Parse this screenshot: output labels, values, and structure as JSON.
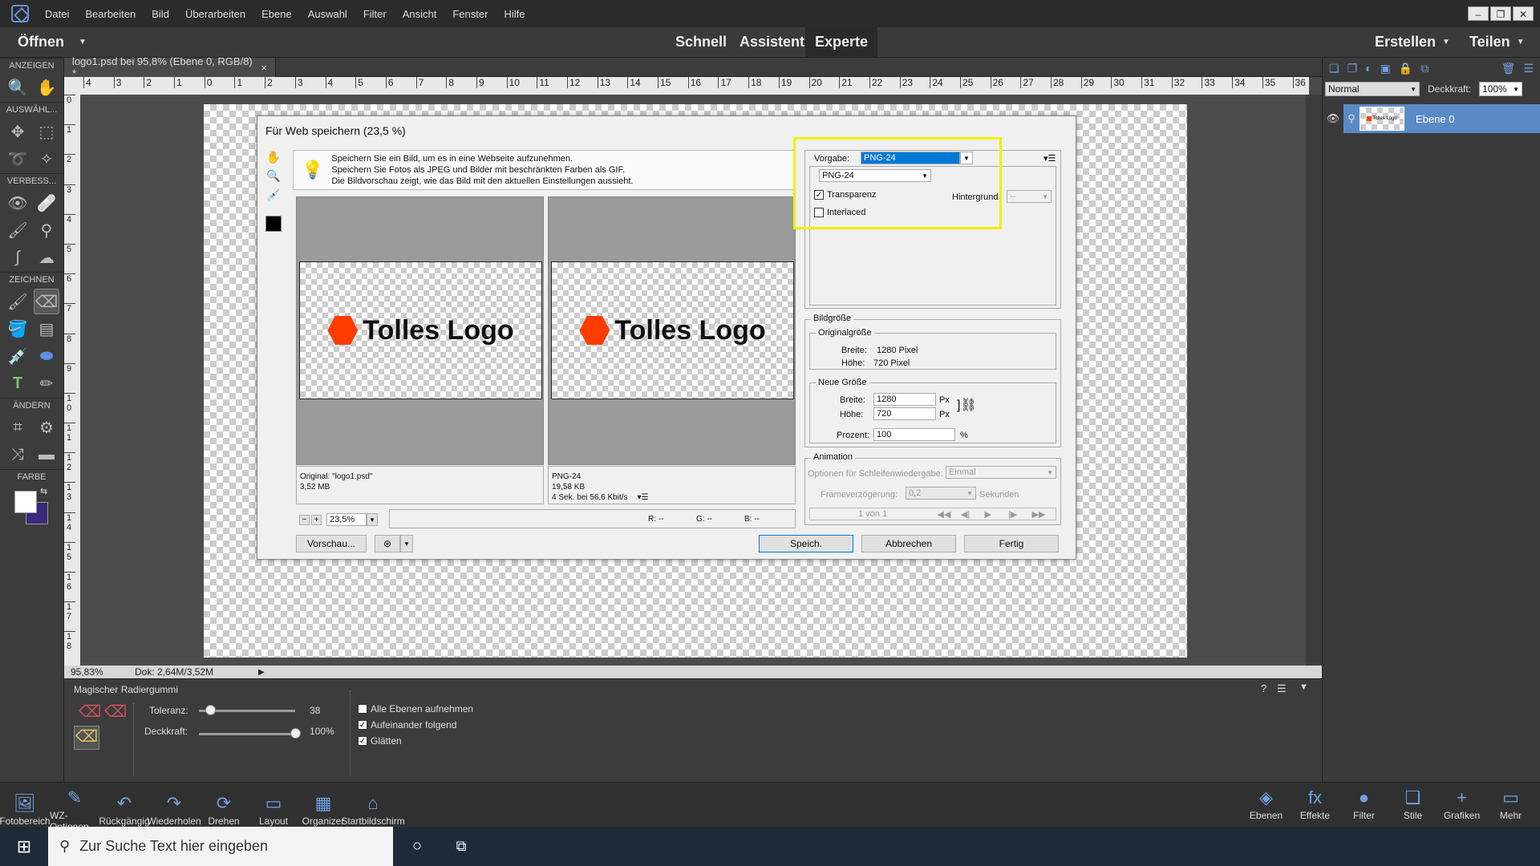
{
  "menubar": {
    "items": [
      "Datei",
      "Bearbeiten",
      "Bild",
      "Überarbeiten",
      "Ebene",
      "Auswahl",
      "Filter",
      "Ansicht",
      "Fenster",
      "Hilfe"
    ],
    "win_min": "–",
    "win_max": "❐",
    "win_close": "✕"
  },
  "modebar": {
    "open": "Öffnen",
    "modes": [
      "Schnell",
      "Assistent",
      "Experte"
    ],
    "create": "Erstellen",
    "share": "Teilen"
  },
  "tools": {
    "sections": [
      "ANZEIGEN",
      "AUSWÄHL...",
      "VERBESS...",
      "ZEICHNEN",
      "ÄNDERN",
      "FARBE"
    ]
  },
  "doc": {
    "tab": "logo1.psd bei 95,8% (Ebene 0, RGB/8) *",
    "close": "×",
    "zoom": "95,83%",
    "docinfo": "Dok: 2,64M/3,52M"
  },
  "ruler": {
    "h": [
      "4",
      "3",
      "2",
      "1",
      "0",
      "1",
      "2",
      "3",
      "4",
      "5",
      "6",
      "7",
      "8",
      "9",
      "10",
      "11",
      "12",
      "13",
      "14",
      "15",
      "16",
      "17",
      "18",
      "19",
      "20",
      "21",
      "22",
      "23",
      "24",
      "25",
      "26",
      "27",
      "28",
      "29",
      "30",
      "31",
      "32",
      "33",
      "34",
      "35",
      "36"
    ],
    "v": [
      "0",
      "1",
      "2",
      "3",
      "4",
      "5",
      "6",
      "7",
      "8",
      "9",
      "1 0",
      "1 1",
      "1 2",
      "1 3",
      "1 4",
      "1 5",
      "1 6",
      "1 7",
      "1 8"
    ]
  },
  "dialog": {
    "title": "Für Web speichern (23,5 %)",
    "info": [
      "Speichern Sie ein Bild, um es in eine Webseite aufzunehmen.",
      "Speichern Sie Fotos als JPEG und Bilder mit beschränkten Farben als GIF.",
      "Die Bildvorschau zeigt, wie das Bild mit den aktuellen Einstellungen aussieht."
    ],
    "logo_text": "Tolles Logo",
    "orig_info": [
      "Original: \"logo1.psd\"",
      "3,52 MB"
    ],
    "opt_info": [
      "PNG-24",
      "19,58 KB",
      "4 Sek. bei 56,6 Kbit/s"
    ],
    "zoom": "23,5%",
    "rgb": [
      "R: --",
      "G: --",
      "B: --"
    ],
    "preset_label": "Vorgabe:",
    "preset_value": "PNG-24",
    "format_value": "PNG-24",
    "transparency": "Transparenz",
    "interlaced": "Interlaced",
    "background_label": "Hintergrund",
    "background_value": "--",
    "imgsize_title": "Bildgröße",
    "origsize_title": "Originalgröße",
    "orig_width_label": "Breite:",
    "orig_width": "1280 Pixel",
    "orig_height_label": "Höhe:",
    "orig_height": "720 Pixel",
    "newsize_title": "Neue Größe",
    "new_width_label": "Breite:",
    "new_width": "1280",
    "new_height_label": "Höhe:",
    "new_height": "720",
    "unit": "Px",
    "percent_label": "Prozent:",
    "percent": "100",
    "percent_unit": "%",
    "anim_title": "Animation",
    "loop_label": "Optionen für Schleifenwiedergabe:",
    "loop_value": "Einmal",
    "delay_label": "Frameverzögerung:",
    "delay_value": "0,2",
    "delay_unit": "Sekunden",
    "frame_counter": "1 von 1",
    "preview_btn": "Vorschau...",
    "save_btn": "Speich.",
    "cancel_btn": "Abbrechen",
    "done_btn": "Fertig"
  },
  "rpanel": {
    "blend": "Normal",
    "opacity_label": "Deckkraft:",
    "opacity": "100%",
    "layer": "Ebene 0",
    "thumb_text": "Tolles Logo"
  },
  "opts": {
    "title": "Magischer Radiergummi",
    "tolerance_label": "Toleranz:",
    "tolerance": "38",
    "tolerance_frac": 0.12,
    "opacity_label": "Deckkraft:",
    "opacity": "100%",
    "opacity_frac": 1.0,
    "cb_all": "Alle Ebenen aufnehmen",
    "cb_contig": "Aufeinander folgend",
    "cb_smooth": "Glätten"
  },
  "bbar": {
    "left": [
      {
        "label": "Fotobereich",
        "icon": "🖼"
      },
      {
        "label": "WZ-Optionen",
        "icon": "✎"
      },
      {
        "label": "Rückgängig",
        "icon": "↶"
      },
      {
        "label": "Wiederholen",
        "icon": "↷"
      },
      {
        "label": "Drehen",
        "icon": "⟳"
      },
      {
        "label": "Layout",
        "icon": "▭"
      },
      {
        "label": "Organizer",
        "icon": "▦"
      },
      {
        "label": "Startbildschirm",
        "icon": "⌂"
      }
    ],
    "right": [
      {
        "label": "Ebenen",
        "icon": "◈"
      },
      {
        "label": "Effekte",
        "icon": "fx"
      },
      {
        "label": "Filter",
        "icon": "●"
      },
      {
        "label": "Stile",
        "icon": "❑"
      },
      {
        "label": "Grafiken",
        "icon": "+"
      },
      {
        "label": "Mehr",
        "icon": "▭"
      }
    ]
  },
  "taskbar": {
    "search": "Zur Suche Text hier eingeben"
  },
  "colors": {
    "accent": "#4b7ac6",
    "highlight": "#f0f000",
    "logo_hex": "#ff3c00"
  }
}
